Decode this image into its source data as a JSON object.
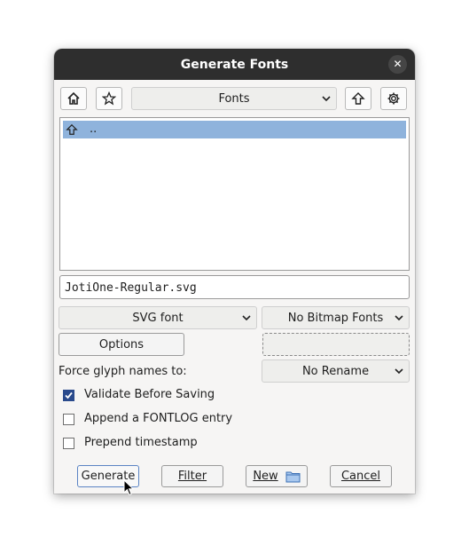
{
  "window": {
    "title": "Generate Fonts"
  },
  "toolbar": {
    "location": "Fonts"
  },
  "file_list": {
    "items": [
      {
        "name": ".."
      }
    ]
  },
  "filename": {
    "value": "JotiOne-Regular.svg"
  },
  "format": {
    "outline": "SVG font",
    "bitmap": "No Bitmap Fonts"
  },
  "options_label": "Options",
  "force_glyph": {
    "label": "Force glyph names to:",
    "value": "No Rename"
  },
  "checkboxes": [
    {
      "label": "Validate Before Saving",
      "checked": true
    },
    {
      "label": "Append a FONTLOG entry",
      "checked": false
    },
    {
      "label": "Prepend timestamp",
      "checked": false
    }
  ],
  "buttons": {
    "generate": "Generate",
    "filter": "Filter",
    "new": "New",
    "cancel": "Cancel"
  },
  "icons": [
    "home-icon",
    "star-icon",
    "up-arrow-icon",
    "gear-icon",
    "folder-icon",
    "close-icon",
    "chevron-down-icon"
  ],
  "colors": {
    "titlebar": "#2e2e2e",
    "selection": "#8fb3dc",
    "checkbox_checked": "#2a4a8c"
  }
}
